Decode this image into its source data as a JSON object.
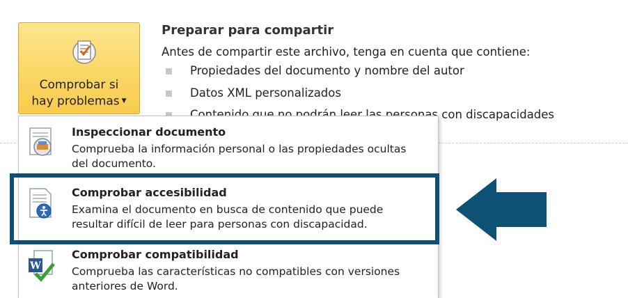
{
  "check_button": {
    "label_line1": "Comprobar si",
    "label_line2": "hay problemas",
    "icon": "checklist-icon"
  },
  "share": {
    "title": "Preparar para compartir",
    "description": "Antes de compartir este archivo, tenga en cuenta que contiene:",
    "bullets": [
      "Propiedades del documento y nombre del autor",
      "Datos XML personalizados",
      "Contenido que no podrán leer las personas con discapacidades"
    ]
  },
  "menu": {
    "items": [
      {
        "title": "Inspeccionar documento",
        "description": "Comprueba la información personal o las propiedades ocultas del documento.",
        "icon": "inspect-document-icon"
      },
      {
        "title": "Comprobar accesibilidad",
        "description": "Examina el documento en busca de contenido que puede resultar difícil de leer para personas con discapacidad.",
        "icon": "accessibility-check-icon"
      },
      {
        "title": "Comprobar compatibilidad",
        "description": "Comprueba las características no compatibles con versiones anteriores de Word.",
        "icon": "word-compatibility-icon"
      }
    ]
  },
  "colors": {
    "highlight": "#0e5076",
    "button_gold": "#fbd768"
  }
}
